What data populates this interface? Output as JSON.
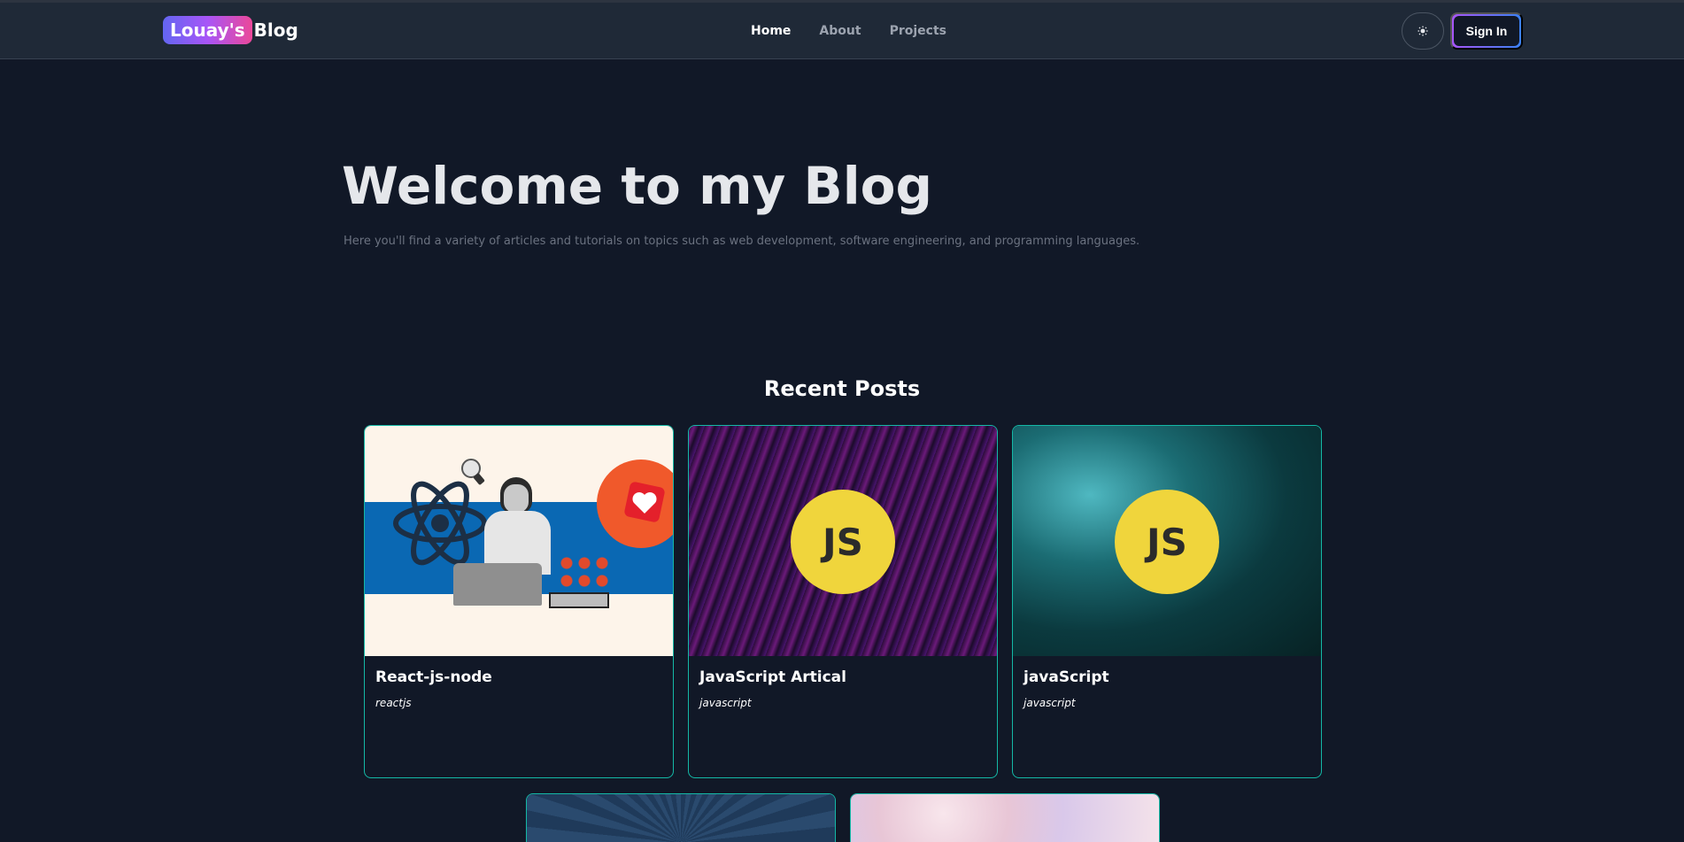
{
  "nav": {
    "brand_badge": "Louay's",
    "brand_rest": "Blog",
    "links": [
      "Home",
      "About",
      "Projects"
    ],
    "theme_icon": "sun-icon",
    "signin": "Sign In"
  },
  "hero": {
    "title": "Welcome to my Blog",
    "subtitle": "Here you'll find a variety of articles and tutorials on topics such as web development, software engineering, and programming languages."
  },
  "recent": {
    "title": "Recent Posts",
    "js_badge": "JS",
    "posts": [
      {
        "title": "React-js-node",
        "category": "reactjs"
      },
      {
        "title": "JavaScript Artical",
        "category": "javascript"
      },
      {
        "title": "javaScript",
        "category": "javascript"
      }
    ]
  },
  "colors": {
    "accent_teal": "#14b8a6",
    "bg": "#111827",
    "nav_bg": "#1f2937"
  }
}
